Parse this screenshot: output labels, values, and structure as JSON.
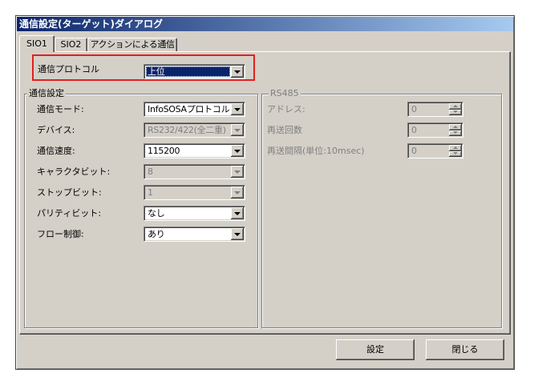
{
  "window": {
    "title": "通信設定(ターゲット)ダイアログ"
  },
  "tabs": [
    {
      "label": "SIO1",
      "selected": true
    },
    {
      "label": "SIO2",
      "selected": false
    },
    {
      "label": "アクションによる通信",
      "selected": false
    }
  ],
  "protocol": {
    "label": "通信プロトコル",
    "value": "上位",
    "focused": true,
    "disabled": false
  },
  "comm_settings": {
    "caption": "通信設定",
    "rows": [
      {
        "label": "通信モード:",
        "value": "InfoSOSAプロトコル",
        "disabled": false
      },
      {
        "label": "デバイス:",
        "value": "RS232/422(全二重)",
        "disabled": true
      },
      {
        "label": "通信速度:",
        "value": "115200",
        "disabled": false
      },
      {
        "label": "キャラクタビット:",
        "value": "8",
        "disabled": true
      },
      {
        "label": "ストップビット:",
        "value": "1",
        "disabled": true
      },
      {
        "label": "パリティビット:",
        "value": "なし",
        "disabled": false
      },
      {
        "label": "フロー制御:",
        "value": "あり",
        "disabled": false
      }
    ]
  },
  "rs485": {
    "caption": "RS485",
    "disabled": true,
    "rows": [
      {
        "label": "アドレス:",
        "value": "0",
        "disabled": true
      },
      {
        "label": "再送回数",
        "value": "0",
        "disabled": true
      },
      {
        "label": "再送間隔(単位:10msec)",
        "value": "0",
        "disabled": true
      }
    ]
  },
  "buttons": {
    "apply": "設定",
    "close": "閉じる"
  },
  "icons": {
    "dropdown": "chevron-down-icon",
    "spin_up": "spin-up-icon",
    "spin_down": "spin-down-icon"
  },
  "colors": {
    "dialog_face": "#D4D0C8",
    "title_start": "#0A246A",
    "title_end": "#A6CAF0",
    "highlight_box": "#E02020",
    "selection": "#0A246A",
    "disabled_text": "#808080"
  }
}
